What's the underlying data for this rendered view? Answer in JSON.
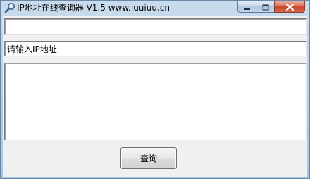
{
  "window": {
    "title": "IP地址在线查询器 V1.5 www.iuuiuu.cn",
    "icon": "magnifier-icon",
    "controls": {
      "minimize": "minimize-icon",
      "maximize": "maximize-icon",
      "close": "close-icon"
    }
  },
  "form": {
    "result_value": "",
    "ip_input_value": "请输入IP地址",
    "detail_value": "",
    "query_button_label": "查询"
  },
  "colors": {
    "titlebar": "#b9d1ea",
    "client_background": "#f0f0f0",
    "close_button": "#c7432a"
  }
}
